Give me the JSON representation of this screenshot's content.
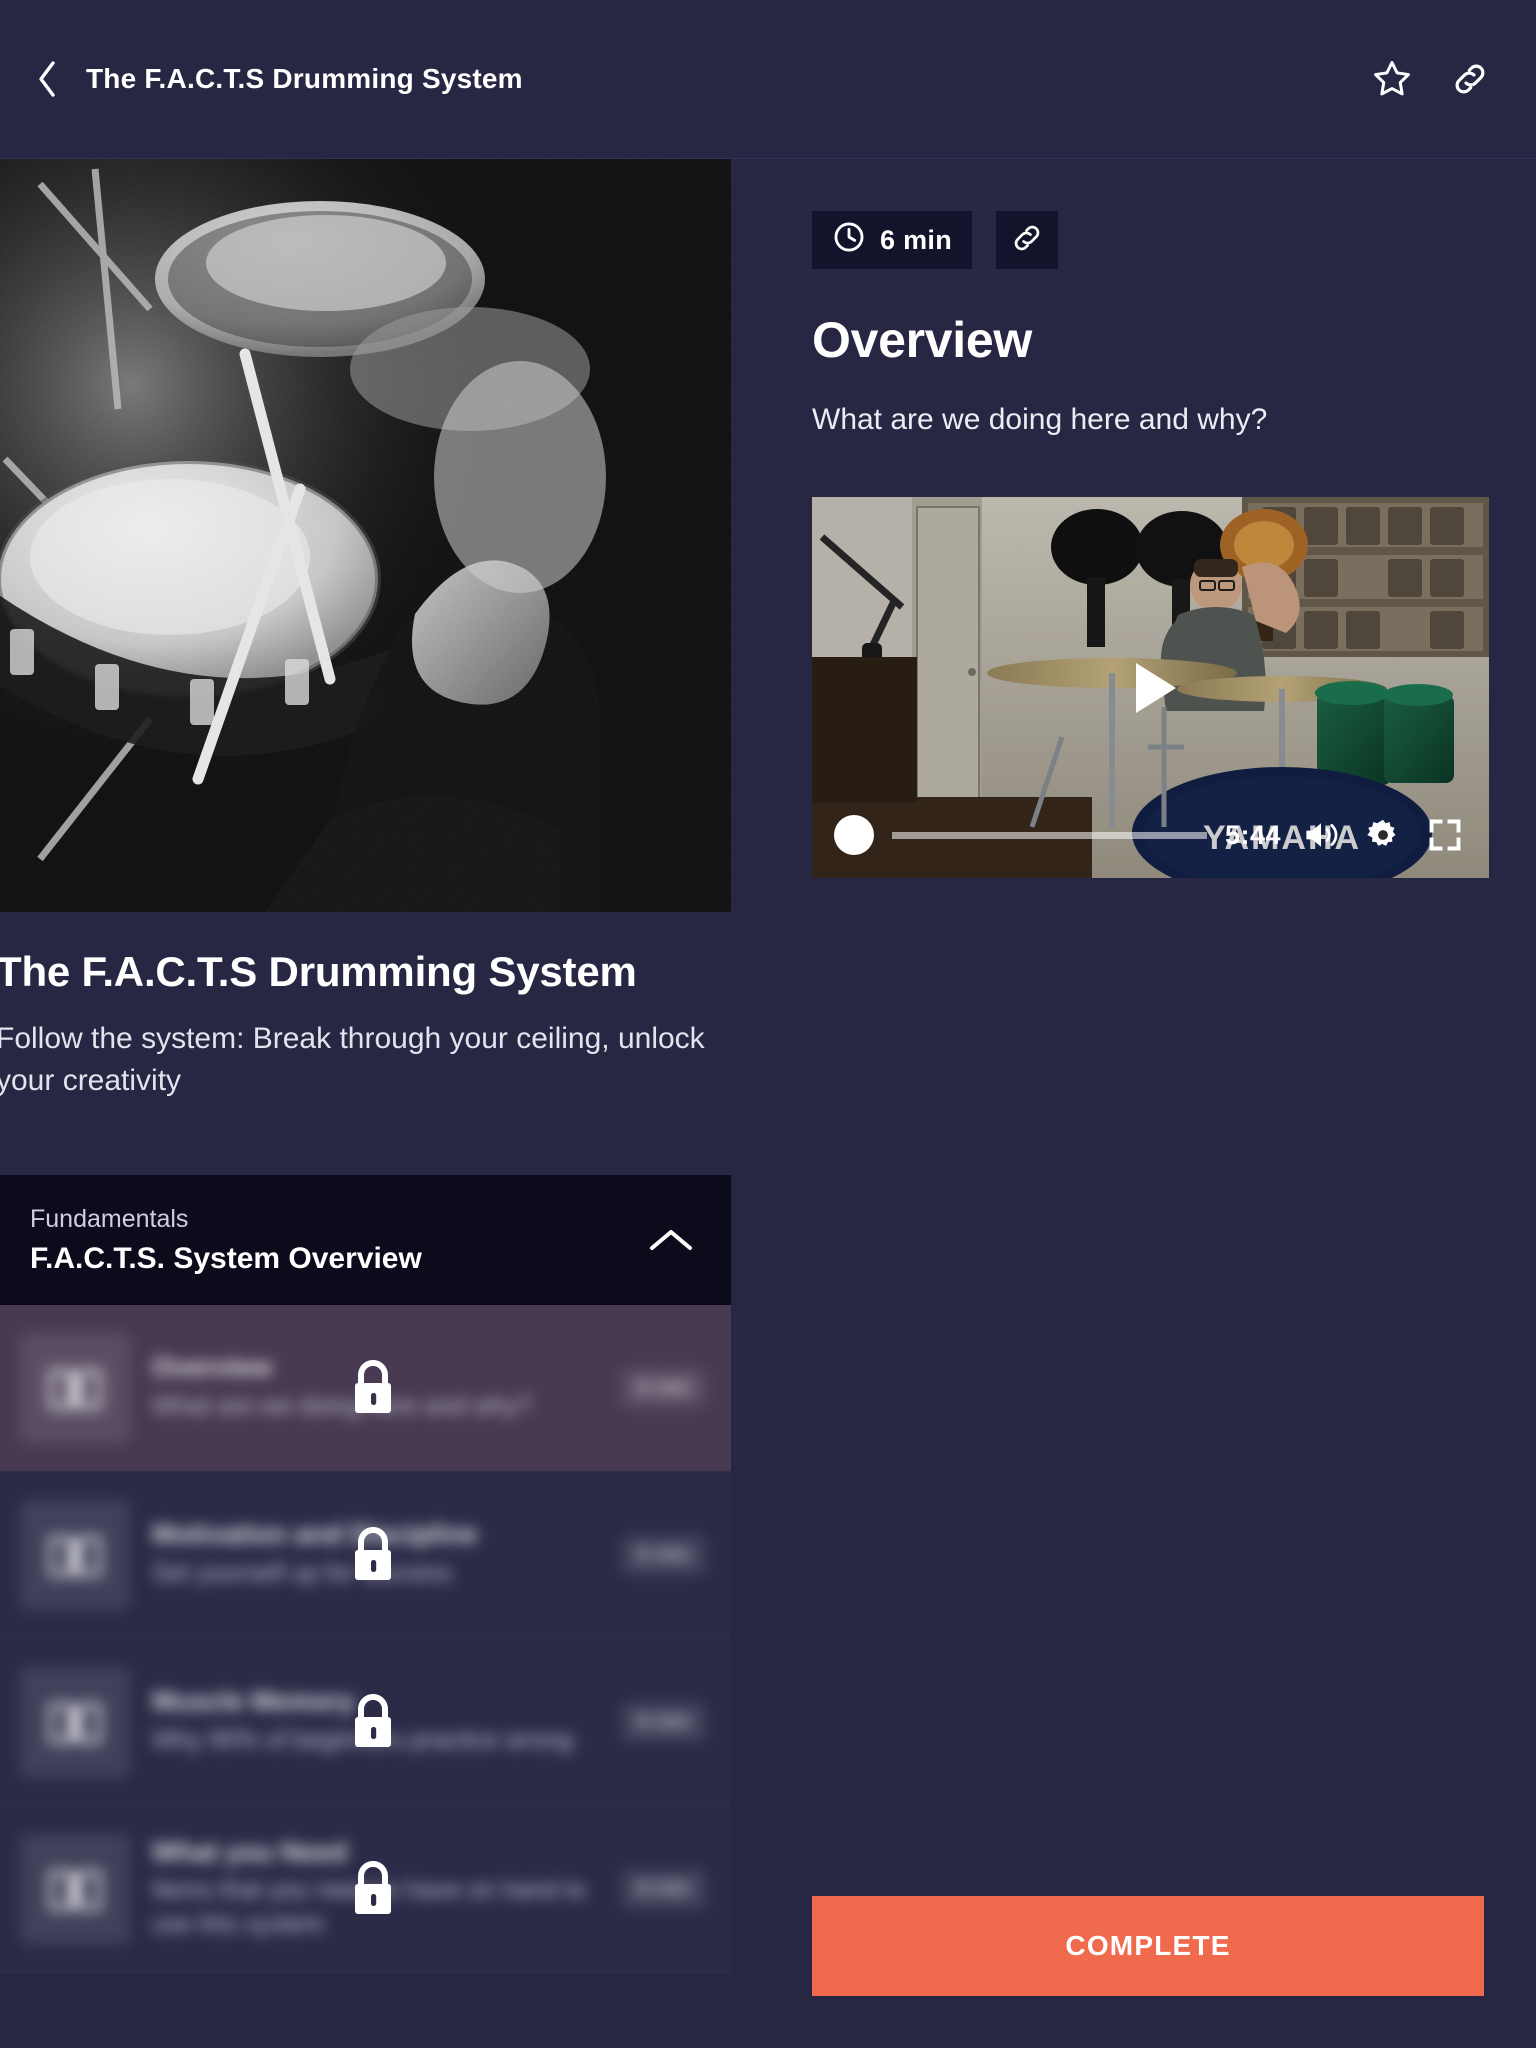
{
  "topbar": {
    "back_icon": "chevron-left-icon",
    "title": "The F.A.C.T.S Drumming System",
    "star_icon": "star-outline-icon",
    "link_icon": "link-icon"
  },
  "course": {
    "hero_image_alt": "black-and-white photo of a drummer playing a kit",
    "title": "The F.A.C.T.S Drumming System",
    "subtitle": "Follow the system: Break through your ceiling, unlock your creativity"
  },
  "section": {
    "kicker": "Fundamentals",
    "title": "F.A.C.T.S. System Overview",
    "collapse_icon": "chevron-up-icon"
  },
  "lessons": [
    {
      "title": "Overview",
      "desc": "What are we doing here and why?",
      "duration": "6 min",
      "thumb_icon": "book-icon",
      "lock_icon": "lock-icon",
      "locked": true,
      "active": true
    },
    {
      "title": "Motivation and Discipline",
      "desc": "Set yourself up for success",
      "duration": "6 min",
      "thumb_icon": "book-icon",
      "lock_icon": "lock-icon",
      "locked": true,
      "active": false
    },
    {
      "title": "Muscle Memory",
      "desc": "Why 90% of beginners practice wrong",
      "duration": "6 min",
      "thumb_icon": "book-icon",
      "lock_icon": "lock-icon",
      "locked": true,
      "active": false
    },
    {
      "title": "What you Need",
      "desc": "Items that you need to have on hand to use this system",
      "duration": "6 min",
      "thumb_icon": "book-icon",
      "lock_icon": "lock-icon",
      "locked": true,
      "active": false
    }
  ],
  "detail": {
    "clock_icon": "clock-icon",
    "duration": "6 min",
    "share_icon": "link-icon",
    "title": "Overview",
    "description": "What are we doing here and why?"
  },
  "player": {
    "play_icon": "play-icon",
    "scrub_position_percent": 6,
    "time_remaining": "5:44",
    "volume_icon": "volume-icon",
    "settings_icon": "gear-icon",
    "fullscreen_icon": "fullscreen-icon",
    "poster_alt": "drummer seated behind a green Yamaha kit in a studio with guitars on the wall"
  },
  "footer": {
    "complete_label": "COMPLETE"
  },
  "colors": {
    "page_bg": "#272743",
    "panel_dark": "#0b0b1c",
    "badge_bg": "#13132b",
    "accent": "#F06A4D",
    "active_row": "#473a52",
    "row": "#2b2b48",
    "text": "#ffffff"
  }
}
